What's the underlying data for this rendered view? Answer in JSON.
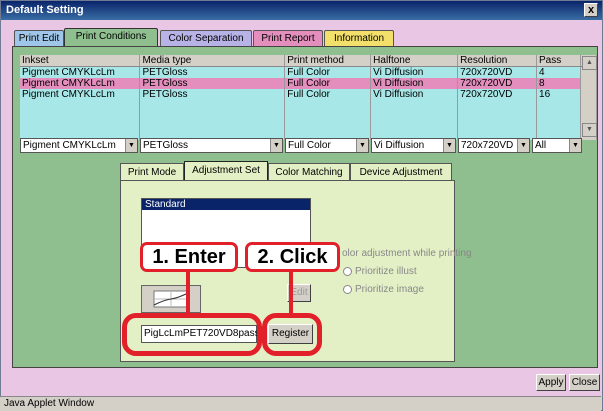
{
  "window": {
    "title": "Default Setting",
    "close_glyph": "x"
  },
  "tabs": [
    "Print Edit",
    "Print Conditions",
    "Color Separation",
    "Print Report",
    "Information"
  ],
  "table": {
    "headers": [
      "Inkset",
      "Media type",
      "Print method",
      "Halftone",
      "Resolution",
      "Pass"
    ],
    "rows": [
      [
        "Pigment CMYKLcLm",
        "PETGloss",
        "Full Color",
        "Vi Diffusion",
        "720x720VD",
        "4"
      ],
      [
        "Pigment CMYKLcLm",
        "PETGloss",
        "Full Color",
        "Vi Diffusion",
        "720x720VD",
        "8"
      ],
      [
        "Pigment CMYKLcLm",
        "PETGloss",
        "Full Color",
        "Vi Diffusion",
        "720x720VD",
        "16"
      ]
    ]
  },
  "combos": [
    "Pigment CMYKLcLm",
    "PETGloss",
    "Full Color",
    "Vi Diffusion",
    "720x720VD",
    "All"
  ],
  "subtabs": [
    "Print Mode",
    "Adjustment Set",
    "Color Matching",
    "Device Adjustment"
  ],
  "adjustment": {
    "list_item": "Standard",
    "color_adj_label": "olor adjustment while printing",
    "radio1": "Prioritize illust",
    "radio2": "Prioritize image",
    "edit_label": "Edit",
    "input_value": "PigLcLmPET720VD8pass",
    "register_label": "Register"
  },
  "callouts": {
    "enter": "1. Enter",
    "click": "2. Click"
  },
  "footer": {
    "apply": "Apply",
    "close": "Close",
    "status": "Java Applet Window"
  },
  "colors": {
    "accent_red": "#e2202a",
    "panel_green": "#8fbf8f",
    "row_cyan": "#a7e7e7",
    "row_pink": "#e48ebe",
    "window_pink": "#e9c6e3"
  }
}
